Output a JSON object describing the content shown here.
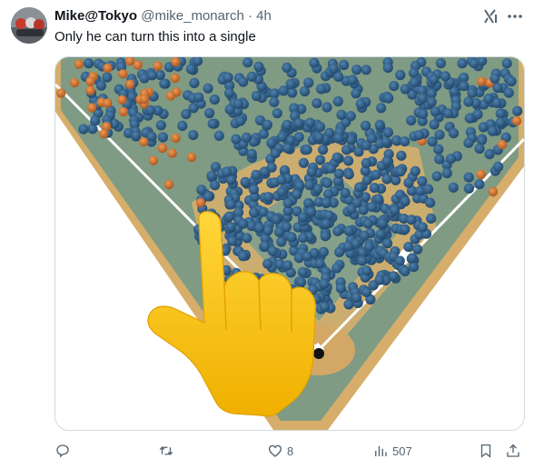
{
  "tweet": {
    "author_name": "Mike@Tokyo",
    "handle": "@mike_monarch",
    "separator": "·",
    "time": "4h",
    "text": "Only he can turn this into a single"
  },
  "media": {
    "description_icon": "pointing-hand-emoji"
  },
  "actions": {
    "reply_count": "",
    "retweet_count": "",
    "like_count": "8",
    "views_count": "507"
  },
  "icons": {
    "grok": "grok-icon",
    "more": "more-icon",
    "reply": "reply-icon",
    "retweet": "retweet-icon",
    "like": "heart-icon",
    "views": "views-icon",
    "bookmark": "bookmark-icon",
    "share": "share-icon"
  },
  "colors": {
    "outfield": "#7f9b83",
    "infield_dirt": "#d9b06d",
    "dot_blue": "#2d5c86",
    "dot_orange": "#c56a2e",
    "emoji_yellow": "#f6c21b",
    "muted": "#536471"
  }
}
